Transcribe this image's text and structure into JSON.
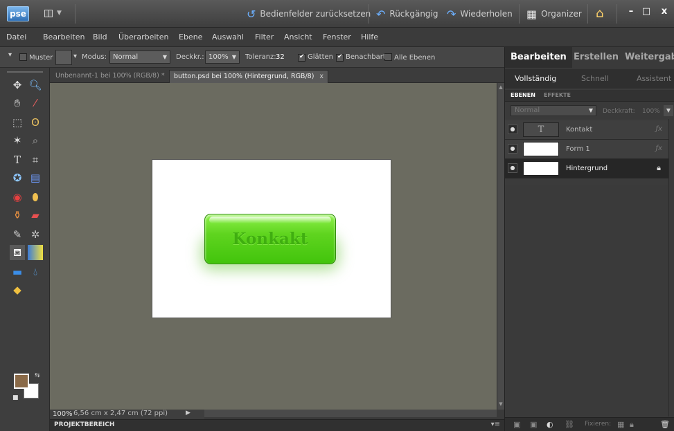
{
  "titlebar": {
    "logo": "pse",
    "reset_panels": "Bedienfelder zurücksetzen",
    "undo": "Rückgängig",
    "redo": "Wiederholen",
    "organizer": "Organizer",
    "minimize": "–",
    "maximize": "□",
    "close": "x"
  },
  "menu": [
    "Datei",
    "Bearbeiten",
    "Bild",
    "Überarbeiten",
    "Ebene",
    "Auswahl",
    "Filter",
    "Ansicht",
    "Fenster",
    "Hilfe"
  ],
  "options": {
    "pattern_label": "Muster",
    "mode_label": "Modus:",
    "mode_value": "Normal",
    "opacity_label": "Deckkr.:",
    "opacity_value": "100%",
    "tolerance_label": "Toleranz:",
    "tolerance_value": "32",
    "smooth_label": "Glätten",
    "contiguous_label": "Benachbart",
    "all_layers_label": "Alle Ebenen"
  },
  "doc_tabs": [
    {
      "label": "Unbenannt-1 bei 100% (RGB/8) *",
      "close": "x"
    },
    {
      "label": "button.psd bei 100% (Hintergrund, RGB/8)",
      "close": "x"
    }
  ],
  "canvas": {
    "button_text": "Konkakt",
    "button_color": "#5fd41f"
  },
  "status": {
    "zoom": "100%",
    "dimensions": "6,56 cm x 2,47 cm (72 ppi)"
  },
  "project_bin": {
    "label": "PROJEKTBEREICH"
  },
  "colors": {
    "foreground": "#8a6a48",
    "background": "#ffffff"
  },
  "right_panel": {
    "tabs": [
      "Bearbeiten",
      "Erstellen",
      "Weitergab"
    ],
    "subtabs": [
      "Vollständig",
      "Schnell",
      "Assistent"
    ],
    "layer_tabs": [
      "EBENEN",
      "EFFEKTE"
    ],
    "blend_mode": "Normal",
    "opacity_label": "Deckkraft:",
    "opacity_value": "100%",
    "layers": [
      {
        "name": "Kontakt",
        "type": "text",
        "thumb": "T"
      },
      {
        "name": "Form 1",
        "type": "shape"
      },
      {
        "name": "Hintergrund",
        "type": "background",
        "selected": true
      }
    ],
    "fix_label": "Fixieren:"
  }
}
